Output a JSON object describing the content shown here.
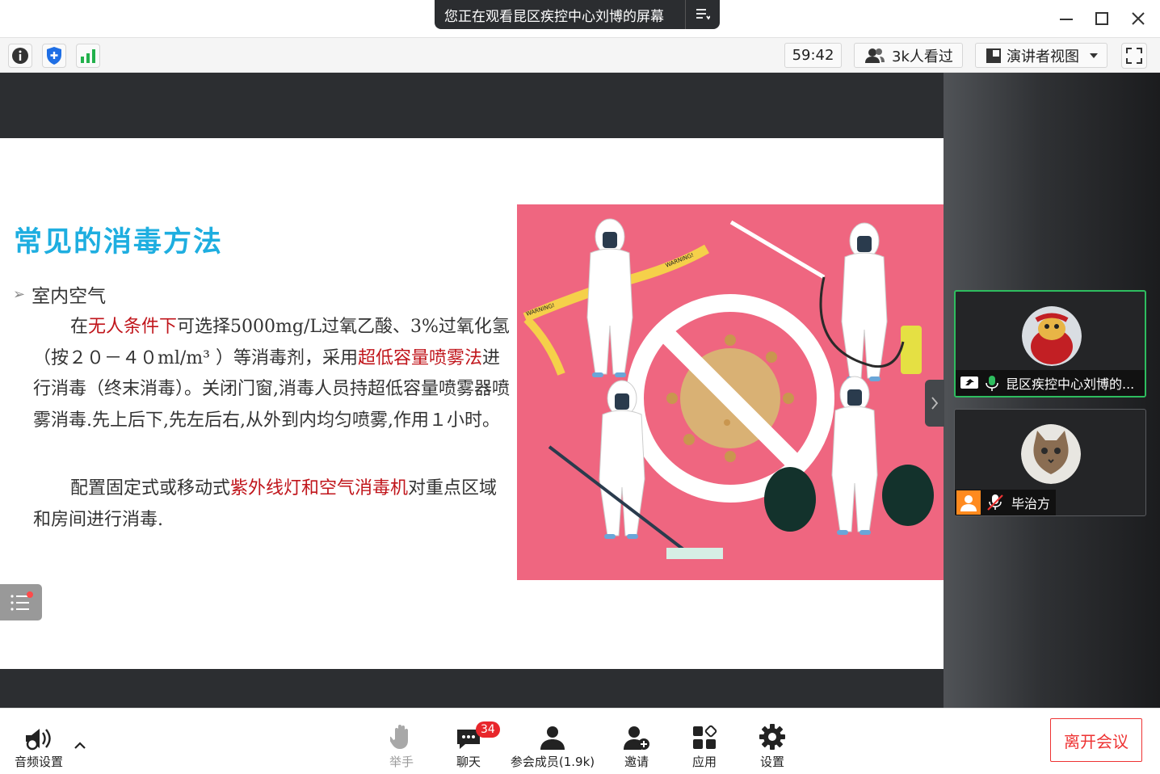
{
  "titlebar": {
    "share_text": "您正在观看昆区疾控中心刘博的屏幕",
    "icons": [
      "menu-icon",
      "minimize-icon",
      "maximize-icon",
      "close-icon"
    ]
  },
  "toolbar": {
    "timer": "59:42",
    "viewers": "3k人看过",
    "view_mode": "演讲者视图",
    "icons": [
      "info-icon",
      "shield-icon",
      "signal-icon",
      "fullscreen-icon"
    ]
  },
  "slide": {
    "title": "常见的消毒方法",
    "bullet": "室内空气",
    "para1": [
      {
        "t": "在",
        "red": false
      },
      {
        "t": "无人条件下",
        "red": true
      },
      {
        "t": "可选择5000mg/L过氧乙酸、3%过氧化氢（按２０－４０ml/m³ ）等消毒剂，采用",
        "red": false
      },
      {
        "t": "超低容量喷雾法",
        "red": true
      },
      {
        "t": "进行消毒（终末消毒）。关闭门窗,消毒人员持超低容量喷雾器喷雾消毒.先上后下,先左后右,从外到内均匀喷雾,作用１小时。",
        "red": false
      }
    ],
    "para2": [
      {
        "t": "配置固定式或移动式",
        "red": false
      },
      {
        "t": "紫外线灯和空气消毒机",
        "red": true
      },
      {
        "t": "对重点区域和房间进行消毒.",
        "red": false
      }
    ],
    "illustration_tape_text": "WARNING!",
    "colors": {
      "title": "#1eaee0",
      "highlight": "#c0151b",
      "illustration_bg": "#ef6680"
    }
  },
  "participants": [
    {
      "name": "昆区疾控中心刘博的...",
      "active": true,
      "icons": [
        "screen-share-icon",
        "microphone-icon"
      ]
    },
    {
      "name": "毕治方",
      "active": false,
      "icons": [
        "user-icon",
        "microphone-muted-icon"
      ]
    }
  ],
  "bottombar": {
    "audio": "音频设置",
    "raise_hand": "举手",
    "chat": "聊天",
    "chat_badge": "34",
    "members": "参会成员(1.9k)",
    "invite": "邀请",
    "apps": "应用",
    "settings": "设置",
    "leave": "离开会议"
  }
}
